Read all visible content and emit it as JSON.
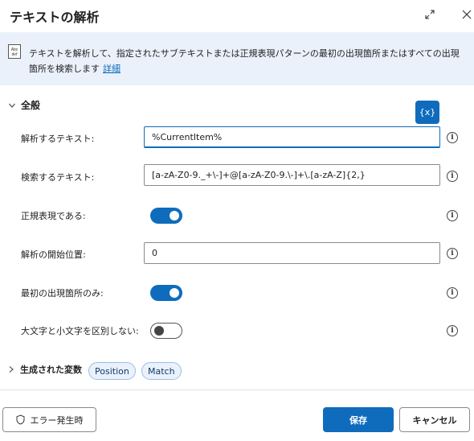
{
  "header": {
    "title": "テキストの解析",
    "expand_icon": "expand-icon",
    "close_icon": "close-icon"
  },
  "info": {
    "icon": "text-parse-icon",
    "text": "テキストを解析して、指定されたサブテキストまたは正規表現パターンの最初の出現箇所またはすべての出現箇所を検索します",
    "link": "詳細"
  },
  "section": {
    "title": "全般",
    "chevron": "chevron-down-icon"
  },
  "variable_button": "{x}",
  "fields": {
    "text_to_parse": {
      "label": "解析するテキスト:",
      "value": "%CurrentItem%"
    },
    "text_to_find": {
      "label": "検索するテキスト:",
      "value": "[a-zA-Z0-9._+\\-]+@[a-zA-Z0-9.\\-]+\\.[a-zA-Z]{2,}"
    },
    "is_regex": {
      "label": "正規表現である:",
      "state": "on"
    },
    "start_position": {
      "label": "解析の開始位置:",
      "value": "0"
    },
    "first_only": {
      "label": "最初の出現箇所のみ:",
      "state": "on"
    },
    "ignore_case": {
      "label": "大文字と小文字を区別しない:",
      "state": "off"
    }
  },
  "help_glyph": "i",
  "variables": {
    "title": "生成された変数",
    "chevron": "chevron-right-icon",
    "items": [
      "Position",
      "Match"
    ]
  },
  "footer": {
    "error_button": "エラー発生時",
    "error_icon": "shield-icon",
    "save": "保存",
    "cancel": "キャンセル"
  },
  "colors": {
    "accent": "#0f6cbd",
    "info_background": "#eaf1fb",
    "chip_border": "#99bfe6"
  }
}
